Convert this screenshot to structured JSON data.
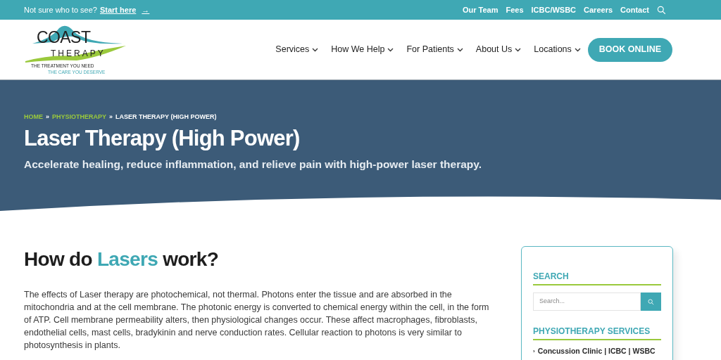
{
  "top_bar": {
    "prompt": "Not sure who to see?",
    "link": "Start here",
    "link_arrow": "→",
    "links": [
      "Our Team",
      "Fees",
      "ICBC/WSBC",
      "Careers",
      "Contact"
    ]
  },
  "logo": {
    "name_top": "COAST",
    "name_bottom": "THERAPY",
    "tagline_1": "THE TREATMENT YOU NEED",
    "tagline_2": "THE CARE YOU DESERVE"
  },
  "nav": {
    "items": [
      "Services",
      "How We Help",
      "For Patients",
      "About Us",
      "Locations"
    ],
    "cta": "BOOK ONLINE"
  },
  "hero": {
    "breadcrumb": [
      {
        "label": "HOME",
        "link": true
      },
      {
        "label": "»",
        "link": false
      },
      {
        "label": "PHYSIOTHERAPY",
        "link": true
      },
      {
        "label": "»",
        "link": false
      },
      {
        "label": "LASER THERAPY (HIGH POWER)",
        "link": false
      }
    ],
    "title": "Laser Therapy (High Power)",
    "subtitle": "Accelerate healing, reduce inflammation, and relieve pain with high-power laser therapy."
  },
  "article": {
    "heading": [
      {
        "text": "How do",
        "highlight": false
      },
      {
        "text": "Lasers",
        "highlight": true
      },
      {
        "text": "work?",
        "highlight": false
      }
    ],
    "paragraph": "The effects of Laser therapy are photochemical, not thermal. Photons enter the tissue and are absorbed in the mitochondria and at the cell membrane. The photonic energy is converted to chemical energy within the cell, in the form of ATP. Cell membrane permeability alters, then physiological changes occur. These affect macrophages, fibroblasts, endothelial cells, mast cells, bradykinin and nerve conduction rates. Cellular reaction to photons is very similar to photosynthesis in plants."
  },
  "sidebar": {
    "search_title": "SEARCH",
    "search": {
      "placeholder": "Search..."
    },
    "services_title": "PHYSIOTHERAPY SERVICES",
    "services": [
      {
        "marker": "›",
        "label": "Concussion Clinic | ICBC | WSBC"
      }
    ]
  }
}
